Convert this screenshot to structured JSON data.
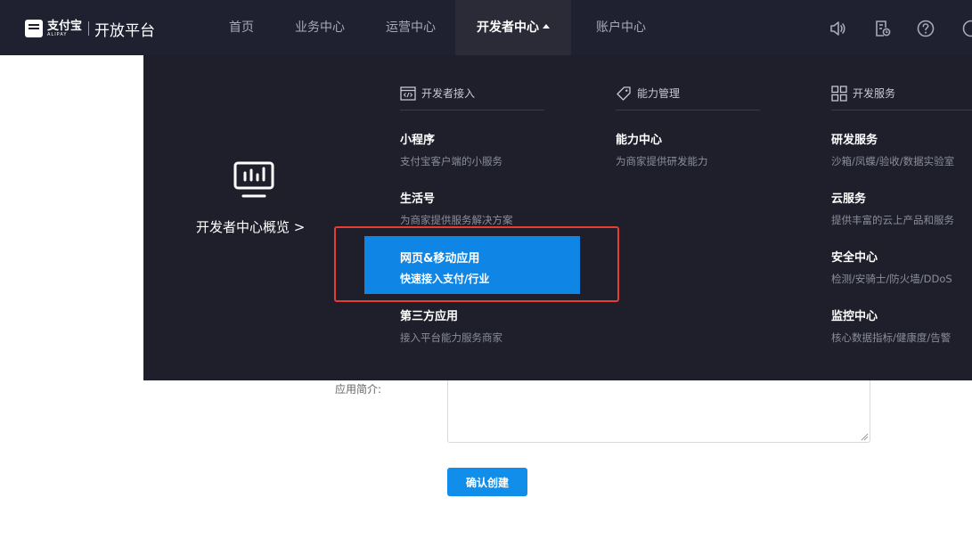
{
  "header": {
    "logo_cn": "支付宝",
    "logo_en": "ALIPAY",
    "platform_title": "开放平台",
    "nav": [
      "首页",
      "业务中心",
      "运营中心",
      "开发者中心",
      "账户中心"
    ],
    "icons": [
      "speaker-icon",
      "document-clock-icon",
      "help-icon"
    ]
  },
  "dropdown": {
    "overview_label": "开发者中心概览 >",
    "columns": [
      {
        "heading": "开发者接入",
        "entries": [
          {
            "title": "小程序",
            "desc": "支付宝客户端的小服务"
          },
          {
            "title": "生活号",
            "desc": "为商家提供服务解决方案"
          },
          {
            "title": "网页&移动应用",
            "desc": "快速接入支付/行业"
          },
          {
            "title": "第三方应用",
            "desc": "接入平台能力服务商家"
          }
        ]
      },
      {
        "heading": "能力管理",
        "entries": [
          {
            "title": "能力中心",
            "desc": "为商家提供研发能力"
          }
        ]
      },
      {
        "heading": "开发服务",
        "entries": [
          {
            "title": "研发服务",
            "desc": "沙箱/凤蝶/验收/数据实验室"
          },
          {
            "title": "云服务",
            "desc": "提供丰富的云上产品和服务"
          },
          {
            "title": "安全中心",
            "desc": "检测/安骑士/防火墙/DDoS"
          },
          {
            "title": "监控中心",
            "desc": "核心数据指标/健康度/告警"
          }
        ]
      }
    ]
  },
  "form": {
    "intro_label": "应用简介:",
    "intro_value": "",
    "confirm_label": "确认创建"
  },
  "colors": {
    "topbar": "#1f2030",
    "dropdown": "#1e1f2a",
    "highlight": "#0f86e6",
    "annotation": "#e63c32",
    "button": "#108ee9"
  }
}
